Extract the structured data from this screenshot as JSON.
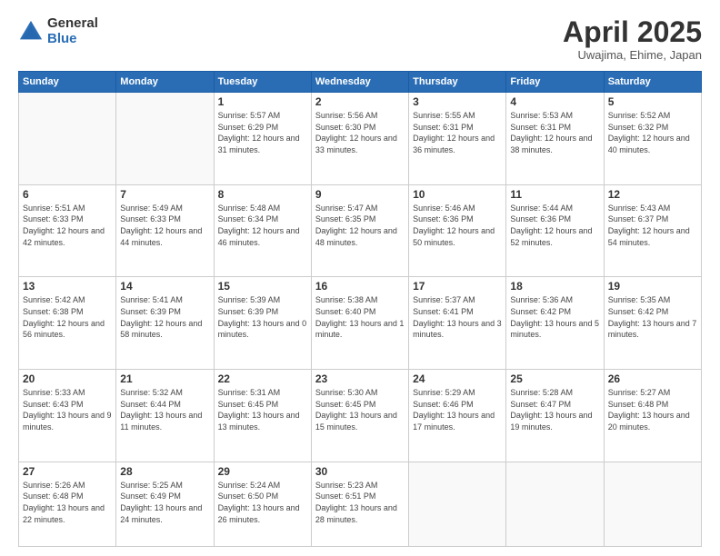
{
  "logo": {
    "general": "General",
    "blue": "Blue"
  },
  "title": "April 2025",
  "subtitle": "Uwajima, Ehime, Japan",
  "days_of_week": [
    "Sunday",
    "Monday",
    "Tuesday",
    "Wednesday",
    "Thursday",
    "Friday",
    "Saturday"
  ],
  "weeks": [
    [
      {
        "day": "",
        "sunrise": "",
        "sunset": "",
        "daylight": ""
      },
      {
        "day": "",
        "sunrise": "",
        "sunset": "",
        "daylight": ""
      },
      {
        "day": "1",
        "sunrise": "Sunrise: 5:57 AM",
        "sunset": "Sunset: 6:29 PM",
        "daylight": "Daylight: 12 hours and 31 minutes."
      },
      {
        "day": "2",
        "sunrise": "Sunrise: 5:56 AM",
        "sunset": "Sunset: 6:30 PM",
        "daylight": "Daylight: 12 hours and 33 minutes."
      },
      {
        "day": "3",
        "sunrise": "Sunrise: 5:55 AM",
        "sunset": "Sunset: 6:31 PM",
        "daylight": "Daylight: 12 hours and 36 minutes."
      },
      {
        "day": "4",
        "sunrise": "Sunrise: 5:53 AM",
        "sunset": "Sunset: 6:31 PM",
        "daylight": "Daylight: 12 hours and 38 minutes."
      },
      {
        "day": "5",
        "sunrise": "Sunrise: 5:52 AM",
        "sunset": "Sunset: 6:32 PM",
        "daylight": "Daylight: 12 hours and 40 minutes."
      }
    ],
    [
      {
        "day": "6",
        "sunrise": "Sunrise: 5:51 AM",
        "sunset": "Sunset: 6:33 PM",
        "daylight": "Daylight: 12 hours and 42 minutes."
      },
      {
        "day": "7",
        "sunrise": "Sunrise: 5:49 AM",
        "sunset": "Sunset: 6:33 PM",
        "daylight": "Daylight: 12 hours and 44 minutes."
      },
      {
        "day": "8",
        "sunrise": "Sunrise: 5:48 AM",
        "sunset": "Sunset: 6:34 PM",
        "daylight": "Daylight: 12 hours and 46 minutes."
      },
      {
        "day": "9",
        "sunrise": "Sunrise: 5:47 AM",
        "sunset": "Sunset: 6:35 PM",
        "daylight": "Daylight: 12 hours and 48 minutes."
      },
      {
        "day": "10",
        "sunrise": "Sunrise: 5:46 AM",
        "sunset": "Sunset: 6:36 PM",
        "daylight": "Daylight: 12 hours and 50 minutes."
      },
      {
        "day": "11",
        "sunrise": "Sunrise: 5:44 AM",
        "sunset": "Sunset: 6:36 PM",
        "daylight": "Daylight: 12 hours and 52 minutes."
      },
      {
        "day": "12",
        "sunrise": "Sunrise: 5:43 AM",
        "sunset": "Sunset: 6:37 PM",
        "daylight": "Daylight: 12 hours and 54 minutes."
      }
    ],
    [
      {
        "day": "13",
        "sunrise": "Sunrise: 5:42 AM",
        "sunset": "Sunset: 6:38 PM",
        "daylight": "Daylight: 12 hours and 56 minutes."
      },
      {
        "day": "14",
        "sunrise": "Sunrise: 5:41 AM",
        "sunset": "Sunset: 6:39 PM",
        "daylight": "Daylight: 12 hours and 58 minutes."
      },
      {
        "day": "15",
        "sunrise": "Sunrise: 5:39 AM",
        "sunset": "Sunset: 6:39 PM",
        "daylight": "Daylight: 13 hours and 0 minutes."
      },
      {
        "day": "16",
        "sunrise": "Sunrise: 5:38 AM",
        "sunset": "Sunset: 6:40 PM",
        "daylight": "Daylight: 13 hours and 1 minute."
      },
      {
        "day": "17",
        "sunrise": "Sunrise: 5:37 AM",
        "sunset": "Sunset: 6:41 PM",
        "daylight": "Daylight: 13 hours and 3 minutes."
      },
      {
        "day": "18",
        "sunrise": "Sunrise: 5:36 AM",
        "sunset": "Sunset: 6:42 PM",
        "daylight": "Daylight: 13 hours and 5 minutes."
      },
      {
        "day": "19",
        "sunrise": "Sunrise: 5:35 AM",
        "sunset": "Sunset: 6:42 PM",
        "daylight": "Daylight: 13 hours and 7 minutes."
      }
    ],
    [
      {
        "day": "20",
        "sunrise": "Sunrise: 5:33 AM",
        "sunset": "Sunset: 6:43 PM",
        "daylight": "Daylight: 13 hours and 9 minutes."
      },
      {
        "day": "21",
        "sunrise": "Sunrise: 5:32 AM",
        "sunset": "Sunset: 6:44 PM",
        "daylight": "Daylight: 13 hours and 11 minutes."
      },
      {
        "day": "22",
        "sunrise": "Sunrise: 5:31 AM",
        "sunset": "Sunset: 6:45 PM",
        "daylight": "Daylight: 13 hours and 13 minutes."
      },
      {
        "day": "23",
        "sunrise": "Sunrise: 5:30 AM",
        "sunset": "Sunset: 6:45 PM",
        "daylight": "Daylight: 13 hours and 15 minutes."
      },
      {
        "day": "24",
        "sunrise": "Sunrise: 5:29 AM",
        "sunset": "Sunset: 6:46 PM",
        "daylight": "Daylight: 13 hours and 17 minutes."
      },
      {
        "day": "25",
        "sunrise": "Sunrise: 5:28 AM",
        "sunset": "Sunset: 6:47 PM",
        "daylight": "Daylight: 13 hours and 19 minutes."
      },
      {
        "day": "26",
        "sunrise": "Sunrise: 5:27 AM",
        "sunset": "Sunset: 6:48 PM",
        "daylight": "Daylight: 13 hours and 20 minutes."
      }
    ],
    [
      {
        "day": "27",
        "sunrise": "Sunrise: 5:26 AM",
        "sunset": "Sunset: 6:48 PM",
        "daylight": "Daylight: 13 hours and 22 minutes."
      },
      {
        "day": "28",
        "sunrise": "Sunrise: 5:25 AM",
        "sunset": "Sunset: 6:49 PM",
        "daylight": "Daylight: 13 hours and 24 minutes."
      },
      {
        "day": "29",
        "sunrise": "Sunrise: 5:24 AM",
        "sunset": "Sunset: 6:50 PM",
        "daylight": "Daylight: 13 hours and 26 minutes."
      },
      {
        "day": "30",
        "sunrise": "Sunrise: 5:23 AM",
        "sunset": "Sunset: 6:51 PM",
        "daylight": "Daylight: 13 hours and 28 minutes."
      },
      {
        "day": "",
        "sunrise": "",
        "sunset": "",
        "daylight": ""
      },
      {
        "day": "",
        "sunrise": "",
        "sunset": "",
        "daylight": ""
      },
      {
        "day": "",
        "sunrise": "",
        "sunset": "",
        "daylight": ""
      }
    ]
  ]
}
